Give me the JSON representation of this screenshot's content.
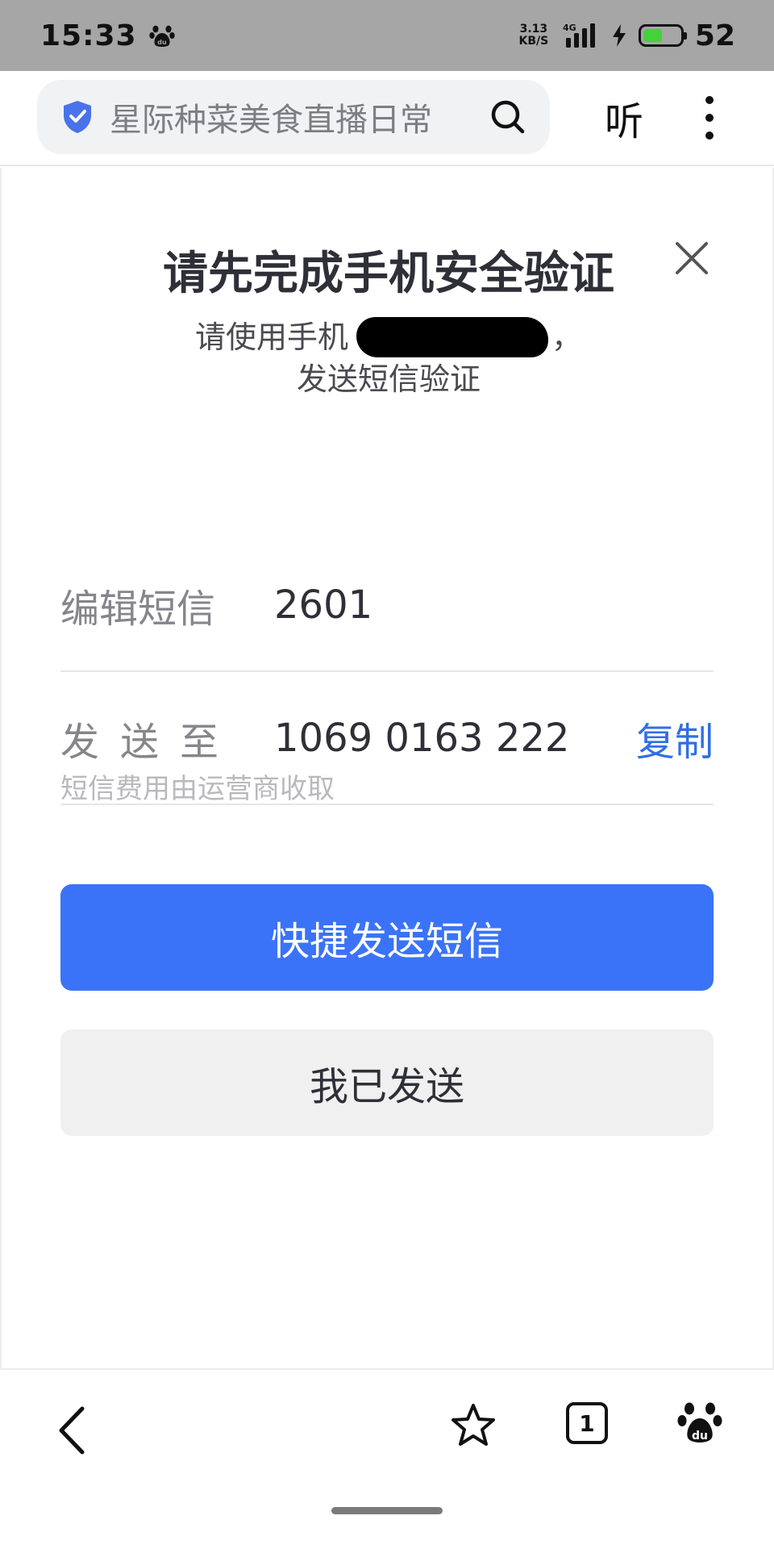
{
  "status_bar": {
    "time": "15:33",
    "net_speed_value": "3.13",
    "net_speed_unit": "KB/S",
    "network_type": "4G",
    "battery_level": "52",
    "icons": [
      "paw-icon",
      "signal-icon",
      "charging-bolt-icon",
      "battery-icon"
    ]
  },
  "browser_bar": {
    "url_text": "星际种菜美食直播日常",
    "listen_label": "听",
    "icons": [
      "shield-icon",
      "search-icon",
      "more-vertical-icon"
    ]
  },
  "verification": {
    "title": "请先完成手机安全验证",
    "subtitle_prefix": "请使用手机",
    "subtitle_suffix": "，",
    "subtitle_line2": "发送短信验证",
    "edit_label": "编辑短信",
    "edit_value": "2601",
    "send_to_label": "发送至",
    "send_to_value": "1069 0163 222",
    "copy_label": "复制",
    "fee_note": "短信费用由运营商收取",
    "primary_button": "快捷发送短信",
    "secondary_button": "我已发送"
  },
  "bottom_nav": {
    "tab_count": "1",
    "icons": [
      "back-icon",
      "star-icon",
      "tabs-icon",
      "paw-icon"
    ]
  },
  "colors": {
    "accent": "#3a73f7",
    "link": "#2f6fe4",
    "status_bar_bg": "#a6a6a6",
    "battery": "#44d13b"
  }
}
